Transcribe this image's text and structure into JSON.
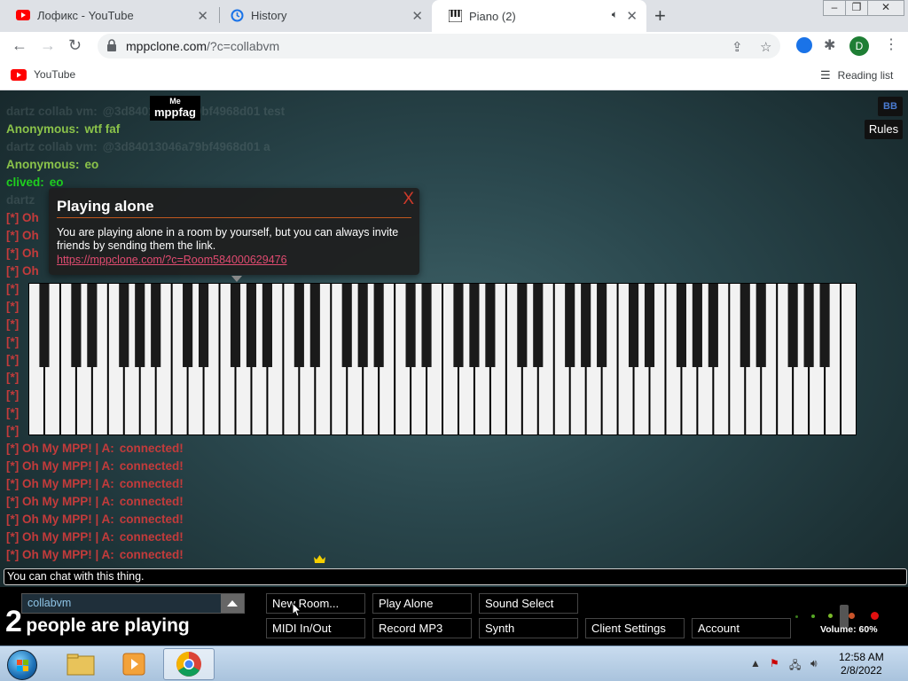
{
  "browser": {
    "tabs": [
      {
        "title": "Лофикс - YouTube",
        "icon": "youtube-icon"
      },
      {
        "title": "History",
        "icon": "history-icon"
      },
      {
        "title": "Piano (2)",
        "icon": "piano-icon",
        "active": true
      }
    ],
    "url_domain": "mppclone.com",
    "url_path": "/?c=collabvm",
    "bookmarks": [
      {
        "label": "YouTube"
      }
    ],
    "reading_list": "Reading list",
    "profile_initial": "D"
  },
  "chat": {
    "messages": [
      {
        "nick": "",
        "text": "",
        "color": "#7f8f91",
        "faded": true
      },
      {
        "nick": "dartz collab vm:",
        "text": "@3d84013046a79bf4968d01 test",
        "color": "#7f8f91",
        "faded": true
      },
      {
        "nick": "Anonymous:",
        "text": "wtf faf",
        "color": "#8bc34a"
      },
      {
        "nick": "dartz collab vm:",
        "text": "@3d84013046a79bf4968d01 a",
        "color": "#7f8f91",
        "faded": true
      },
      {
        "nick": "Anonymous:",
        "text": "eo",
        "color": "#8bc34a"
      },
      {
        "nick": "clived:",
        "text": "eo",
        "color": "#1fcf1f"
      },
      {
        "nick": "dartz",
        "text": "",
        "color": "#7f8f91",
        "faded": true
      },
      {
        "nick": "[*] Oh",
        "text": "",
        "color": "#c33b3b"
      },
      {
        "nick": "[*] Oh",
        "text": "",
        "color": "#c33b3b"
      },
      {
        "nick": "[*] Oh",
        "text": "",
        "color": "#c33b3b"
      },
      {
        "nick": "[*] Oh",
        "text": "",
        "color": "#c33b3b"
      },
      {
        "nick": "[*]",
        "text": "",
        "color": "#c33b3b"
      },
      {
        "nick": "[*]",
        "text": "",
        "color": "#c33b3b"
      },
      {
        "nick": "[*]",
        "text": "",
        "color": "#c33b3b"
      },
      {
        "nick": "[*]",
        "text": "",
        "color": "#c33b3b"
      },
      {
        "nick": "[*]",
        "text": "",
        "color": "#c33b3b"
      },
      {
        "nick": "[*]",
        "text": "",
        "color": "#c33b3b"
      },
      {
        "nick": "[*]",
        "text": "",
        "color": "#c33b3b"
      },
      {
        "nick": "[*]",
        "text": "",
        "color": "#c33b3b"
      },
      {
        "nick": "[*]",
        "text": "",
        "color": "#c33b3b"
      },
      {
        "nick": "[*] Oh My MPP! | A:",
        "text": "connected!",
        "color": "#c33b3b"
      },
      {
        "nick": "[*] Oh My MPP! | A:",
        "text": "connected!",
        "color": "#c33b3b"
      },
      {
        "nick": "[*] Oh My MPP! | A:",
        "text": "connected!",
        "color": "#c33b3b"
      },
      {
        "nick": "[*] Oh My MPP! | A:",
        "text": "connected!",
        "color": "#c33b3b"
      },
      {
        "nick": "[*] Oh My MPP! | A:",
        "text": "connected!",
        "color": "#c33b3b"
      },
      {
        "nick": "[*] Oh My MPP! | A:",
        "text": "connected!",
        "color": "#c33b3b"
      },
      {
        "nick": "[*] Oh My MPP! | A:",
        "text": "connected!",
        "color": "#c33b3b"
      }
    ],
    "input_placeholder": "You can chat with this thing."
  },
  "me_tag": {
    "label": "Me",
    "name": "mppfag"
  },
  "top_right": {
    "bb": "BB",
    "rules": "Rules"
  },
  "notice": {
    "title": "Playing alone",
    "close": "X",
    "text": "You are playing alone in a room by yourself, but you can always invite friends by sending them the link.",
    "link": "https://mppclone.com/?c=Room584000629476"
  },
  "room": {
    "name": "collabvm",
    "count": "2",
    "count_text": "people are playing"
  },
  "buttons": {
    "new_room": "New Room...",
    "play_alone": "Play Alone",
    "sound_select": "Sound Select",
    "midi": "MIDI In/Out",
    "record": "Record MP3",
    "synth": "Synth",
    "client_settings": "Client Settings",
    "account": "Account"
  },
  "volume": {
    "label": "Volume: 60%",
    "level": 0.6
  },
  "taskbar": {
    "time": "12:58 AM",
    "date": "2/8/2022"
  },
  "colors": {
    "accent_orange": "#c0571e",
    "link_pink": "#e04b70",
    "room_text": "#8ec4e6"
  }
}
